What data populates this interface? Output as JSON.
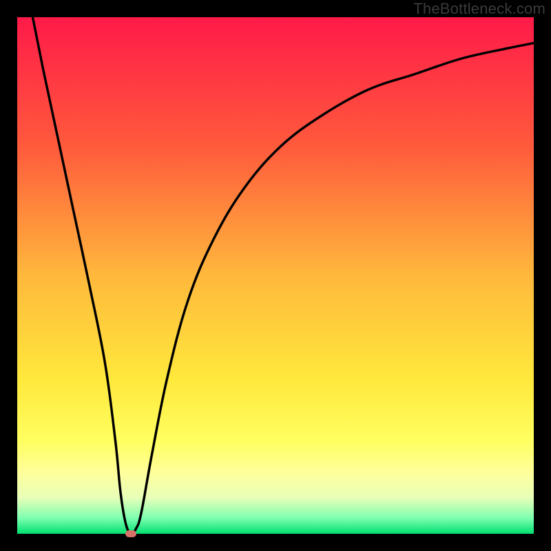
{
  "watermark": "TheBottleneck.com",
  "chart_data": {
    "type": "line",
    "title": "",
    "xlabel": "",
    "ylabel": "",
    "xlim": [
      0,
      100
    ],
    "ylim": [
      0,
      100
    ],
    "grid": false,
    "note": "Values are estimated from pixel positions; no axis ticks are present in the image.",
    "series": [
      {
        "name": "bottleneck-curve",
        "x": [
          3,
          5,
          8,
          11,
          14,
          17,
          19,
          20,
          21,
          22,
          23,
          24,
          26,
          29,
          33,
          38,
          44,
          51,
          59,
          68,
          77,
          86,
          95,
          100
        ],
        "y": [
          100,
          90,
          76,
          62,
          48,
          33,
          18,
          8,
          2,
          0,
          1,
          4,
          15,
          30,
          45,
          57,
          67,
          75,
          81,
          86,
          89,
          92,
          94,
          95
        ]
      }
    ],
    "marker": {
      "name": "optimal-point",
      "x": 22,
      "y": 0
    },
    "background_gradient": {
      "stops": [
        {
          "pct": 0,
          "color": "#ff1a49"
        },
        {
          "pct": 25,
          "color": "#ff5a3c"
        },
        {
          "pct": 50,
          "color": "#ffb83c"
        },
        {
          "pct": 70,
          "color": "#ffe83c"
        },
        {
          "pct": 82,
          "color": "#ffff60"
        },
        {
          "pct": 88,
          "color": "#ffff9a"
        },
        {
          "pct": 93,
          "color": "#e8ffb8"
        },
        {
          "pct": 97,
          "color": "#7cffb0"
        },
        {
          "pct": 100,
          "color": "#00e070"
        }
      ]
    }
  }
}
